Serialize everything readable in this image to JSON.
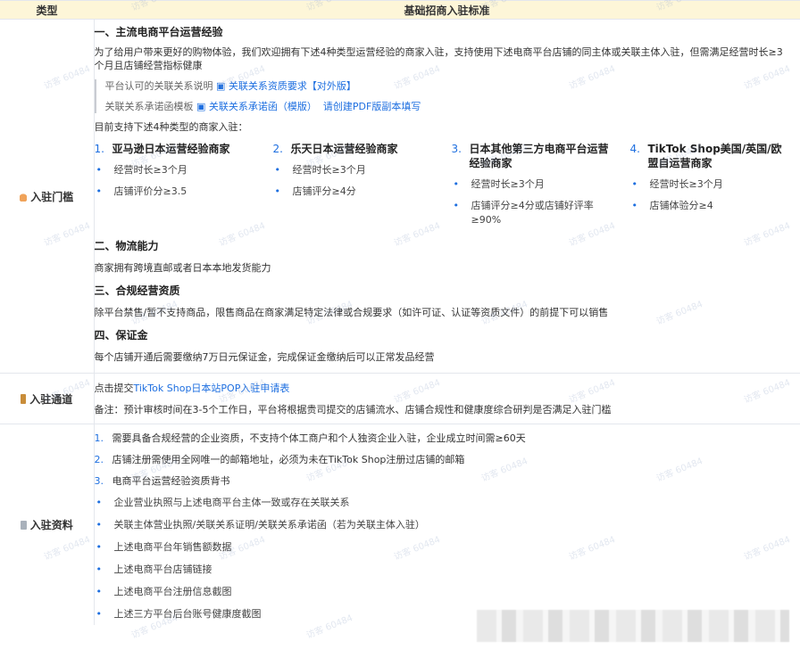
{
  "watermark_text": "访客 60484",
  "header": {
    "col1": "类型",
    "col2": "基础招商入驻标准"
  },
  "row1": {
    "label": "入驻门槛",
    "icon": "flame-icon",
    "s1_title": "一、主流电商平台运营经验",
    "s1_intro": "为了给用户带来更好的购物体验，我们欢迎拥有下述4种类型运营经验的商家入驻，支持使用下述电商平台店铺的同主体或关联主体入驻，但需满足经营时长≥3个月且店铺经营指标健康",
    "rel_desc_prefix": "平台认可的关联关系说明",
    "rel_desc_link": "关联关系资质要求【对外版】",
    "rel_tpl_prefix": "关联关系承诺函模板",
    "rel_tpl_link": "关联关系承诺函（模版）",
    "rel_tpl_suffix": "请创建PDF版副本填写",
    "support_text": "目前支持下述4种类型的商家入驻：",
    "types": [
      {
        "num": "1.",
        "title": "亚马逊日本运营经验商家",
        "bullets": [
          "经营时长≥3个月",
          "店铺评价分≥3.5"
        ]
      },
      {
        "num": "2.",
        "title": "乐天日本运营经验商家",
        "bullets": [
          "经营时长≥3个月",
          "店铺评分≥4分"
        ]
      },
      {
        "num": "3.",
        "title": "日本其他第三方电商平台运营经验商家",
        "bullets": [
          "经营时长≥3个月",
          "店铺评分≥4分或店铺好评率≥90%"
        ]
      },
      {
        "num": "4.",
        "title": "TikTok Shop美国/英国/欧盟自运营商家",
        "bullets": [
          "经营时长≥3个月",
          "店铺体验分≥4"
        ]
      }
    ],
    "s2_title": "二、物流能力",
    "s2_text": "商家拥有跨境直邮或者日本本地发货能力",
    "s3_title": "三、合规经营资质",
    "s3_text": "除平台禁售/暂不支持商品，限售商品在商家满足特定法律或合规要求（如许可证、认证等资质文件）的前提下可以销售",
    "s4_title": "四、保证金",
    "s4_text": "每个店铺开通后需要缴纳7万日元保证金，完成保证金缴纳后可以正常发品经营"
  },
  "row2": {
    "label": "入驻通道",
    "icon": "door-icon",
    "line1_prefix": "点击提交",
    "line1_link": "TikTok Shop日本站POP入驻申请表",
    "line2": "备注：预计审核时间在3-5个工作日，平台将根据贵司提交的店铺流水、店铺合规性和健康度综合研判是否满足入驻门槛"
  },
  "row3": {
    "label": "入驻资料",
    "icon": "document-icon",
    "numbered": [
      {
        "num": "1.",
        "text": "需要具备合规经营的企业资质，不支持个体工商户和个人独资企业入驻，企业成立时间需≥60天"
      },
      {
        "num": "2.",
        "text": "店铺注册需使用全网唯一的邮箱地址，必须为未在TikTok Shop注册过店铺的邮箱"
      },
      {
        "num": "3.",
        "text": "电商平台运营经验资质背书"
      }
    ],
    "bullets": [
      "企业营业执照与上述电商平台主体一致或存在关联关系",
      "关联主体营业执照/关联关系证明/关联关系承诺函（若为关联主体入驻）",
      "上述电商平台年销售额数据",
      "上述电商平台店铺链接",
      "上述电商平台注册信息截图",
      "上述三方平台后台账号健康度截图"
    ]
  },
  "colors": {
    "header_bg": "#fdf6d8",
    "link": "#1e6fe0",
    "border": "#e4e7ed"
  }
}
